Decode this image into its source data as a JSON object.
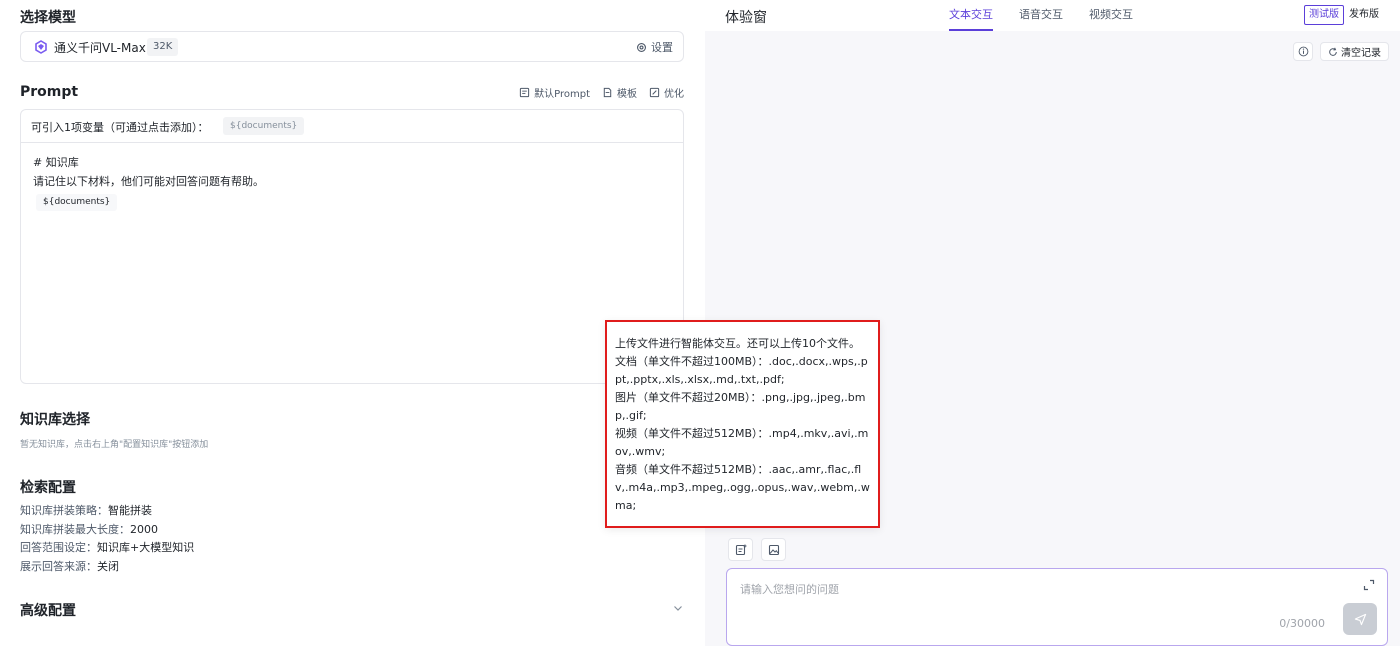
{
  "left": {
    "model_section_title": "选择模型",
    "model_name": "通义千问VL-Max",
    "model_context": "32K",
    "settings_label": "设置",
    "prompt_title": "Prompt",
    "prompt_tools": [
      "默认Prompt",
      "模板",
      "优化"
    ],
    "variable_label": "可引入1项变量（可通过点击添加）：",
    "variable_chip": "${documents}",
    "prompt_lines": [
      "# 知识库",
      "请记住以下材料，他们可能对回答问题有帮助。"
    ],
    "prompt_var": "${documents}",
    "kb_title": "知识库选择",
    "kb_hint": "暂无知识库，点击右上角\"配置知识库\"按钮添加",
    "retrieval_title": "检索配置",
    "retrieval_items": [
      {
        "label": "知识库拼装策略：",
        "value": "智能拼装"
      },
      {
        "label": "知识库拼装最大长度：",
        "value": "2000"
      },
      {
        "label": "回答范围设定：",
        "value": "知识库+大模型知识"
      },
      {
        "label": "展示回答来源：",
        "value": "关闭"
      }
    ],
    "advanced_title": "高级配置"
  },
  "right": {
    "title": "体验窗",
    "tabs": [
      "文本交互",
      "语音交互",
      "视频交互"
    ],
    "active_tab": 0,
    "version_buttons": [
      "测试版",
      "发布版"
    ],
    "clear_label": "清空记录",
    "input_placeholder": "请输入您想问的问题",
    "counter": "0/30000"
  },
  "tooltip": {
    "lines": [
      "上传文件进行智能体交互。还可以上传10个文件。",
      "文档（单文件不超过100MB）：.doc,.docx,.wps,.ppt,.pptx,.xls,.xlsx,.md,.txt,.pdf;",
      "图片（单文件不超过20MB）：.png,.jpg,.jpeg,.bmp,.gif;",
      "视频（单文件不超过512MB）：.mp4,.mkv,.avi,.mov,.wmv;",
      "音频（单文件不超过512MB）：.aac,.amr,.flac,.flv,.m4a,.mp3,.mpeg,.ogg,.opus,.wav,.webm,.wma;"
    ]
  },
  "colors": {
    "accent": "#5b3fd9",
    "highlight_border": "#e01c1c"
  }
}
